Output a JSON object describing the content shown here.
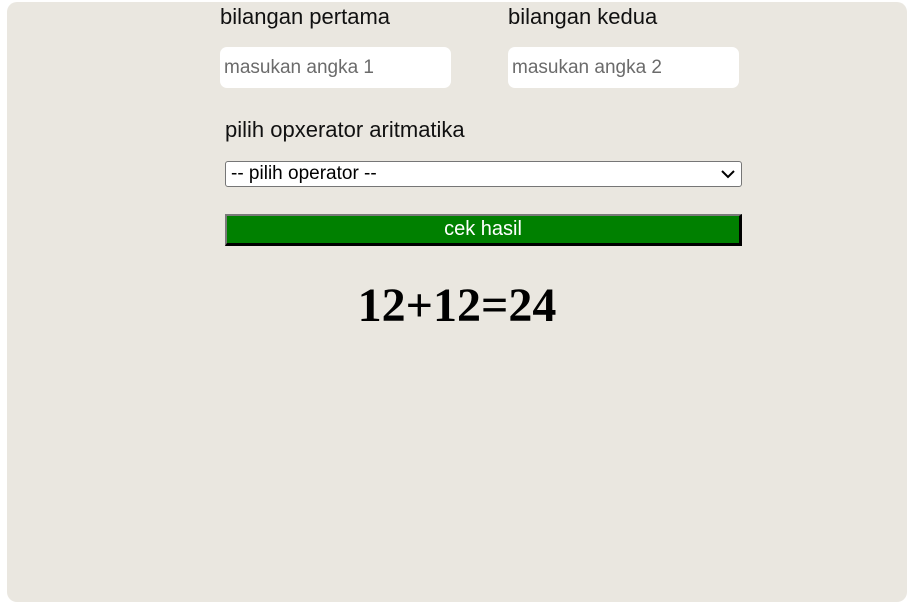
{
  "form": {
    "first_label": "bilangan pertama",
    "second_label": "bilangan kedua",
    "first_placeholder": "masukan angka 1",
    "second_placeholder": "masukan angka 2",
    "first_value": "",
    "second_value": "",
    "operator_label": "pilih opxerator aritmatika",
    "operator_selected": "-- pilih operator --",
    "submit_label": "cek hasil"
  },
  "result": {
    "text": "12+12=24"
  },
  "icons": {
    "select_arrow": "chevron-down-icon"
  },
  "colors": {
    "card_background": "#eae7e0",
    "button_background": "#008000",
    "button_text": "#ffffff"
  }
}
